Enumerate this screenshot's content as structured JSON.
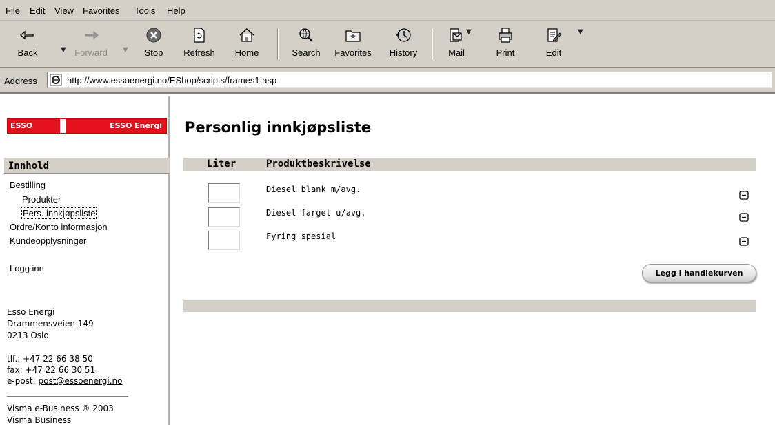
{
  "menu": [
    "File",
    "Edit",
    "View",
    "Favorites",
    "Tools",
    "Help"
  ],
  "toolbar": {
    "back": "Back",
    "forward": "Forward",
    "stop": "Stop",
    "refresh": "Refresh",
    "home": "Home",
    "search": "Search",
    "favorites": "Favorites",
    "history": "History",
    "mail": "Mail",
    "print": "Print",
    "edit": "Edit"
  },
  "address": {
    "label": "Address",
    "url": "http://www.essoenergi.no/EShop/scripts/frames1.asp"
  },
  "logo": {
    "left": "ESSO",
    "right": "ESSO Energi"
  },
  "sidebar": {
    "heading": "Innhold",
    "links": [
      "Bestilling",
      "Produkter",
      "Pers. innkjøpsliste",
      "Ordre/Konto informasjon",
      "Kundeopplysninger"
    ],
    "login": "Logg inn",
    "company": "Esso Energi",
    "street": "Drammensveien 149",
    "city": "0213 Oslo",
    "phone": "tlf.: +47 22 66 38 50",
    "fax": "fax: +47 22 66 30 51",
    "email_label": "e-post:",
    "email": "post@essoenergi.no",
    "copyright": "Visma e-Business ® 2003",
    "visma_link": "Visma Business"
  },
  "main": {
    "title": "Personlig innkjøpsliste",
    "col_liter": "Liter",
    "col_product": "Produktbeskrivelse",
    "products": [
      {
        "name": "Diesel blank m/avg.",
        "liter": ""
      },
      {
        "name": "Diesel farget u/avg.",
        "liter": ""
      },
      {
        "name": "Fyring spesial",
        "liter": ""
      }
    ],
    "add_to_cart": "Legg i handlekurven"
  }
}
